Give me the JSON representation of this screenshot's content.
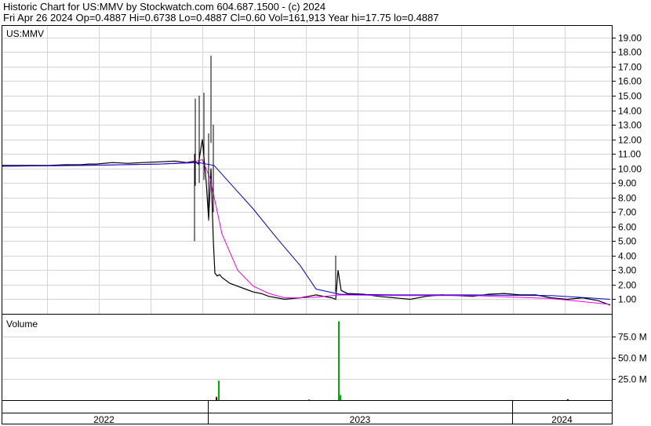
{
  "header": {
    "line1": "Historic Chart for US:MMV by Stockwatch.com 604.687.1500 - (c) 2024",
    "line2": "Fri Apr 26 2024   Op=0.4887   Hi=0.6738   Lo=0.4887   Cl=0.60   Vol=161,913   Year hi=17.75   lo=0.4887"
  },
  "chart_data": [
    {
      "type": "line",
      "panel_label": "US:MMV",
      "ylim": [
        0,
        19.8
      ],
      "y_ticks": [
        "1.00",
        "2.00",
        "3.00",
        "4.00",
        "5.00",
        "6.00",
        "7.00",
        "8.00",
        "9.00",
        "10.00",
        "11.00",
        "12.00",
        "13.00",
        "14.00",
        "15.00",
        "16.00",
        "17.00",
        "18.00",
        "19.00"
      ],
      "grid": true,
      "colors": {
        "price": "#000000",
        "ma_fast": "#ee00ee",
        "ma_slow": "#0000cc",
        "grid": "#d4d4d4"
      },
      "series": [
        {
          "role": "price",
          "x": [
            0,
            20,
            40,
            60,
            80,
            100,
            110,
            120,
            140,
            160,
            180,
            200,
            220,
            235,
            245,
            250,
            255,
            260,
            263,
            266,
            269,
            271,
            274,
            277,
            280,
            290,
            300,
            310,
            320,
            330,
            340,
            350,
            360,
            370,
            380,
            390,
            400,
            410,
            420,
            425,
            428,
            432,
            440,
            460,
            480,
            500,
            520,
            540,
            560,
            580,
            600,
            620,
            640,
            660,
            680,
            700,
            720,
            740,
            760,
            775
          ],
          "y": [
            10.2,
            10.2,
            10.2,
            10.2,
            10.25,
            10.25,
            10.3,
            10.3,
            10.4,
            10.35,
            10.4,
            10.45,
            10.5,
            10.4,
            10.5,
            10.3,
            12.0,
            9.0,
            6.5,
            10.0,
            5.0,
            2.8,
            2.6,
            2.7,
            2.5,
            2.1,
            1.9,
            1.7,
            1.5,
            1.4,
            1.2,
            1.1,
            1.0,
            1.05,
            1.1,
            1.2,
            1.3,
            1.2,
            1.1,
            1.0,
            3.0,
            1.6,
            1.4,
            1.35,
            1.2,
            1.1,
            1.0,
            1.2,
            1.3,
            1.25,
            1.2,
            1.35,
            1.4,
            1.3,
            1.3,
            1.1,
            1.0,
            1.1,
            0.9,
            0.6
          ]
        },
        {
          "role": "ma_fast",
          "x": [
            0,
            100,
            200,
            240,
            255,
            265,
            280,
            300,
            320,
            340,
            360,
            380,
            400,
            430,
            500,
            600,
            700,
            775
          ],
          "y": [
            10.15,
            10.2,
            10.3,
            10.4,
            10.6,
            9.3,
            5.5,
            3.0,
            1.9,
            1.4,
            1.1,
            1.1,
            1.15,
            1.3,
            1.25,
            1.25,
            1.05,
            0.65
          ],
          "peak_label": "17.75"
        },
        {
          "role": "ma_slow",
          "x": [
            0,
            100,
            200,
            250,
            270,
            290,
            320,
            350,
            380,
            400,
            430,
            500,
            600,
            700,
            775
          ],
          "y": [
            10.15,
            10.2,
            10.3,
            10.4,
            10.2,
            9.0,
            7.2,
            5.2,
            3.3,
            1.7,
            1.35,
            1.3,
            1.3,
            1.25,
            1.0
          ]
        }
      ]
    },
    {
      "type": "bar",
      "panel_label": "Volume",
      "ylim": [
        0,
        100
      ],
      "y_ticks": [
        "25.0 M",
        "50.0 M",
        "75.0 M"
      ],
      "colors": {
        "up": "#00aa00",
        "down": "#cc0000",
        "flat": "#000000"
      },
      "bars": [
        {
          "x": 272,
          "v": 4,
          "c": "down"
        },
        {
          "x": 275,
          "v": 23,
          "c": "up"
        },
        {
          "x": 272,
          "v": 2,
          "c": "flat"
        },
        {
          "x": 428,
          "v": 93,
          "c": "up"
        },
        {
          "x": 430,
          "v": 6,
          "c": "up"
        },
        {
          "x": 390,
          "v": 0.5,
          "c": "flat"
        },
        {
          "x": 720,
          "v": 1,
          "c": "flat"
        }
      ]
    }
  ],
  "x_axis": {
    "labels": [
      "2022",
      "2023",
      "2024"
    ],
    "year_starts": [
      0,
      265,
      653,
      780
    ]
  }
}
